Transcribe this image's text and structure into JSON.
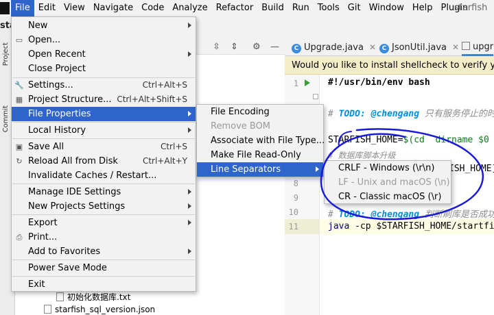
{
  "menubar": {
    "items": [
      "File",
      "Edit",
      "View",
      "Navigate",
      "Code",
      "Analyze",
      "Refactor",
      "Build",
      "Run",
      "Tools",
      "Git",
      "Window",
      "Help",
      "Plugin"
    ],
    "project_name": "starfish"
  },
  "crumb": "sta",
  "side_tabs": [
    "Project",
    "Commit"
  ],
  "project_tree": [
    {
      "label": "初始化数据库.txt"
    },
    {
      "label": "starfish_sql_version.json"
    }
  ],
  "editor_tabs": [
    {
      "label": "Upgrade.java"
    },
    {
      "label": "JsonUtil.java"
    },
    {
      "label": "upgr"
    }
  ],
  "banner": "Would you like to install shellcheck to verify your shell scripts?",
  "code_lines": {
    "l1": "#!/usr/bin/env bash",
    "l3_todo": "TODO: @chengang",
    "l3_rest": " 只有服务停止的时",
    "l5_a": "STARFISH_HOME=",
    "l5_b": "$(cd `dirname $0",
    "l6": "# 数据库脚本升级",
    "l7": "ISH_HOME]",
    "l10_todo": "TODO: @chengang",
    "l10_rest": " 判断刷库是否成功",
    "l11_kw": "java",
    "l11_rest": " -cp $STARFISH_HOME/startfi"
  },
  "line_numbers": {
    "n8": "8",
    "n9": "9",
    "n10": "10",
    "n11": "11"
  },
  "file_menu": {
    "new": "New",
    "open": "Open...",
    "open_recent": "Open Recent",
    "close_project": "Close Project",
    "settings": "Settings...",
    "settings_sc": "Ctrl+Alt+S",
    "project_structure": "Project Structure...",
    "project_structure_sc": "Ctrl+Alt+Shift+S",
    "file_properties": "File Properties",
    "local_history": "Local History",
    "save_all": "Save All",
    "save_all_sc": "Ctrl+S",
    "reload": "Reload All from Disk",
    "reload_sc": "Ctrl+Alt+Y",
    "invalidate": "Invalidate Caches / Restart...",
    "manage_ide": "Manage IDE Settings",
    "new_projects": "New Projects Settings",
    "export": "Export",
    "print": "Print...",
    "favorites": "Add to Favorites",
    "power_save": "Power Save Mode",
    "exit": "Exit"
  },
  "file_properties_menu": {
    "encoding": "File Encoding",
    "remove_bom": "Remove BOM",
    "associate": "Associate with File Type...",
    "read_only": "Make File Read-Only",
    "line_separators": "Line Separators"
  },
  "line_separators_menu": {
    "crlf": "CRLF - Windows (\\r\\n)",
    "lf": "LF - Unix and macOS (\\n)",
    "cr": "CR - Classic macOS (\\r)"
  },
  "colors": {
    "highlight": "#2f65ca",
    "annotation": "#1a1ad8"
  }
}
